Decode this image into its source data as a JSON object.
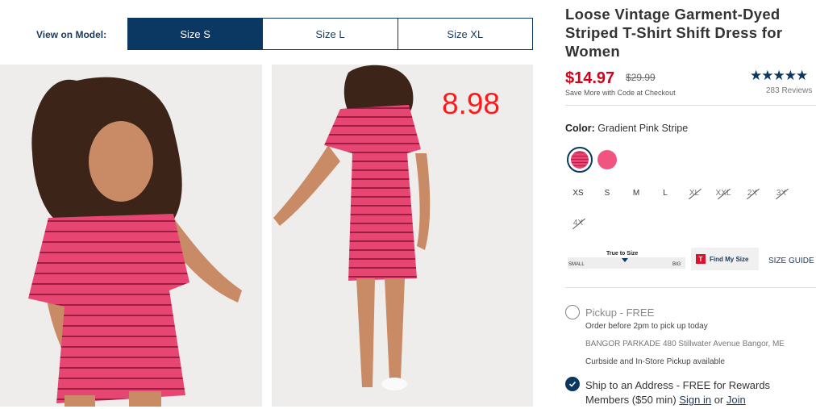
{
  "view_on_model": {
    "label": "View on Model:",
    "options": [
      {
        "label": "Size S",
        "active": true
      },
      {
        "label": "Size L",
        "active": false
      },
      {
        "label": "Size XL",
        "active": false
      }
    ]
  },
  "overlay_price": "8.98",
  "product": {
    "title": "Loose Vintage Garment-Dyed Striped T-Shirt Shift Dress for Women",
    "sale_price": "$14.97",
    "original_price": "$29.99",
    "save_more": "Save More with Code at Checkout",
    "stars": "★★★★★",
    "reviews": "283 Reviews"
  },
  "color": {
    "label": "Color:",
    "value": "Gradient Pink Stripe"
  },
  "sizes": [
    {
      "label": "XS",
      "available": true
    },
    {
      "label": "S",
      "available": true
    },
    {
      "label": "M",
      "available": true
    },
    {
      "label": "L",
      "available": true
    },
    {
      "label": "XL",
      "available": false
    },
    {
      "label": "XXL",
      "available": false
    },
    {
      "label": "2X",
      "available": false
    },
    {
      "label": "3X",
      "available": false
    },
    {
      "label": "4X",
      "available": false
    }
  ],
  "fit": {
    "label": "True to Size",
    "small": "SMALL",
    "big": "BIG",
    "find_my_size": "Find My Size",
    "size_guide": "SIZE GUIDE"
  },
  "pickup": {
    "title": "Pickup - FREE",
    "line1": "Order before 2pm to pick up today",
    "line2": "BANGOR PARKADE 480 Stillwater Avenue  Bangor, ME",
    "line3": "Curbside and In-Store Pickup available"
  },
  "shipping": {
    "text": "Ship to an Address - FREE for Rewards Members ($50 min)",
    "signin": "Sign in",
    "or": "or",
    "join": "Join"
  },
  "colors": {
    "navy": "#0b3862",
    "sale_red": "#d0021b",
    "overlay_red": "#ff1a1a",
    "dress_pink": "#e84672"
  }
}
